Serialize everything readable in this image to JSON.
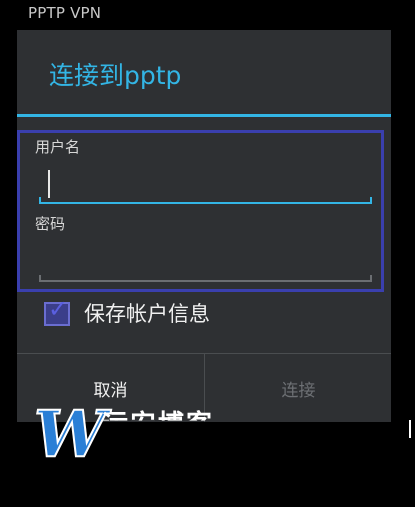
{
  "background": {
    "list_item": "PPTP VPN"
  },
  "dialog": {
    "title": "连接到pptp",
    "username_label": "用户名",
    "username_value": "",
    "password_label": "密码",
    "password_value": "",
    "save_checkbox_label": "保存帐户信息",
    "save_checked": true,
    "cancel_label": "取消",
    "connect_label": "连接"
  },
  "watermark": {
    "letter": "W",
    "text": "运安博客"
  },
  "colors": {
    "accent": "#33b5e5",
    "dialog_bg": "#2e3033",
    "highlight": "#3a3fae",
    "disabled_text": "#6d7074"
  }
}
